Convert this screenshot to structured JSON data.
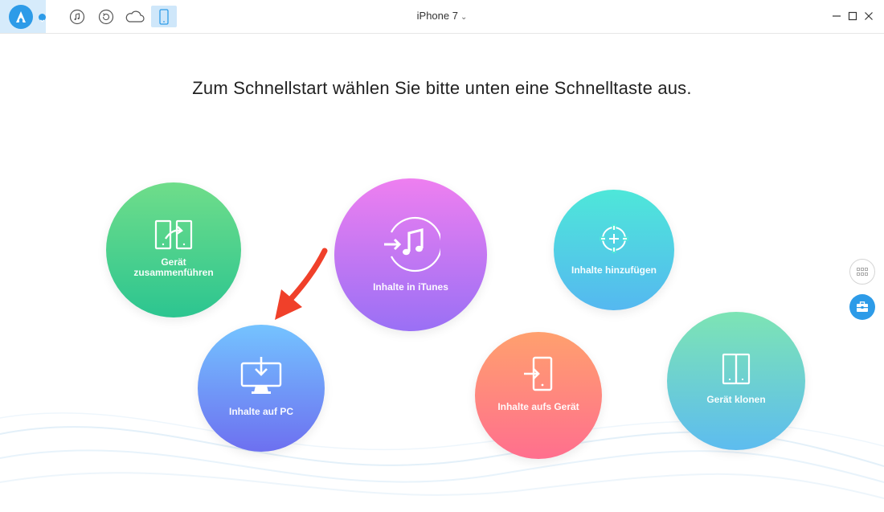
{
  "window": {
    "device_name": "iPhone 7",
    "device_caret": "⌄"
  },
  "toolbar": {
    "icons": [
      "app-logo-icon",
      "music-icon",
      "restore-icon",
      "cloud-icon",
      "phone-icon"
    ],
    "window_controls": [
      "minimize-icon",
      "maximize-icon",
      "close-icon"
    ]
  },
  "main": {
    "headline": "Zum Schnellstart wählen Sie bitte unten eine Schnelltaste aus.",
    "shortcuts": {
      "merge": "Gerät\nzusammenführen",
      "itunes": "Inhalte in iTunes",
      "add": "Inhalte hinzufügen",
      "pc": "Inhalte auf PC",
      "device": "Inhalte aufs Gerät",
      "clone": "Gerät klonen"
    }
  },
  "colors": {
    "accent": "#2d9be8",
    "arrow": "#f0402a"
  }
}
